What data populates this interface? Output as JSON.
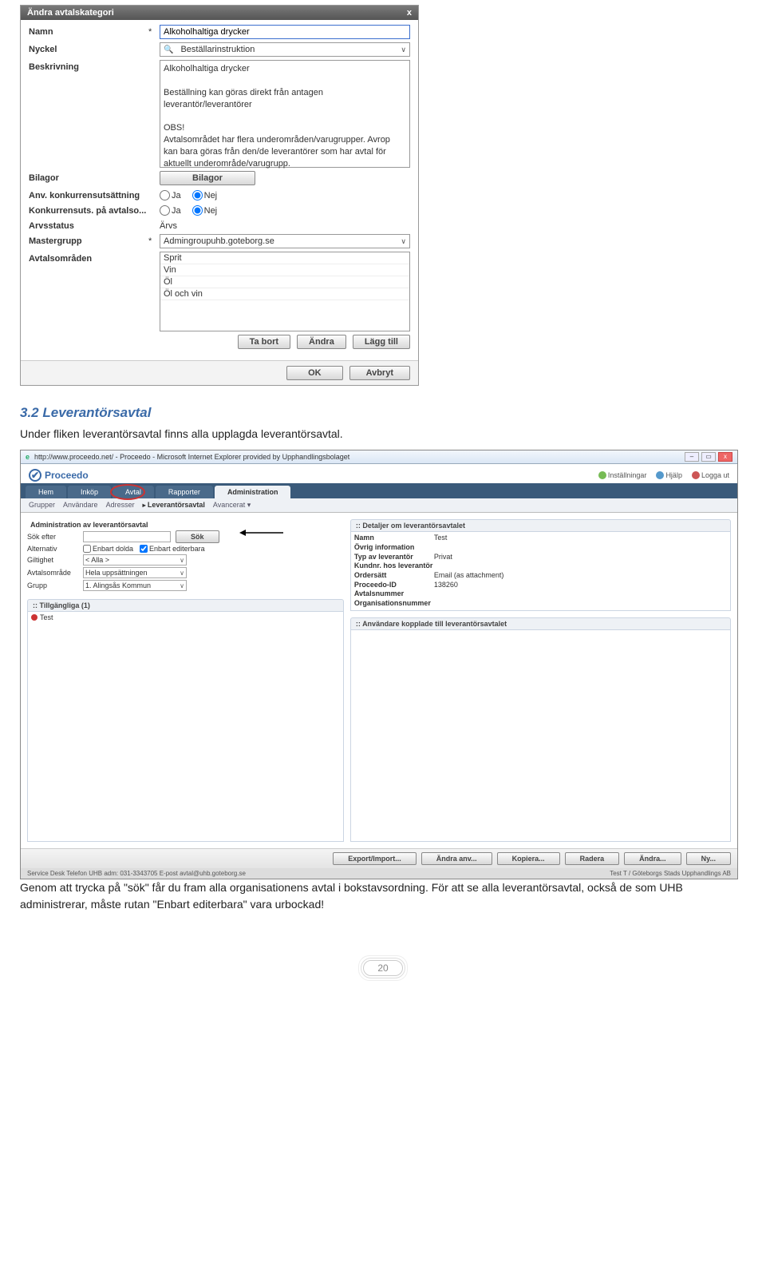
{
  "dialog": {
    "title": "Ändra avtalskategori",
    "rows": {
      "namn_label": "Namn",
      "namn_value": "Alkoholhaltiga drycker",
      "nyckel_label": "Nyckel",
      "nyckel_value": "Beställarinstruktion",
      "beskrivning_label": "Beskrivning",
      "beskrivning_value": "Alkoholhaltiga drycker\n\nBeställning kan göras direkt från antagen leverantör/leverantörer\n\nOBS!\nAvtalsområdet har flera underområden/varugrupper. Avrop kan bara göras från den/de leverantörer som har avtal för aktuellt underområde/varugrupp.",
      "bilagor_label": "Bilagor",
      "bilagor_btn": "Bilagor",
      "anv_label": "Anv. konkurrensutsättning",
      "konk_label": "Konkurrensuts. på avtalso...",
      "ja": "Ja",
      "nej": "Nej",
      "arv_label": "Arvsstatus",
      "arv_value": "Ärvs",
      "master_label": "Mastergrupp",
      "master_value": "Admingroupuhb.goteborg.se",
      "omraden_label": "Avtalsområden",
      "omraden": [
        "Sprit",
        "Vin",
        "Öl",
        "Öl och vin"
      ]
    },
    "btns": {
      "tabort": "Ta bort",
      "andra": "Ändra",
      "laggtill": "Lägg till",
      "ok": "OK",
      "avbryt": "Avbryt"
    }
  },
  "heading": "3.2  Leverantörsavtal",
  "para1": "Under fliken leverantörsavtal finns alla upplagda leverantörsavtal.",
  "admin": {
    "url_text": "http://www.proceedo.net/ - Proceedo - Microsoft Internet Explorer provided by Upphandlingsbolaget",
    "brand": "Proceedo",
    "userlinks": {
      "inst": "Inställningar",
      "hjalp": "Hjälp",
      "logga": "Logga ut"
    },
    "tabs": [
      "Hem",
      "Inköp",
      "Avtal",
      "Rapporter",
      "Administration"
    ],
    "subnav": [
      "Grupper",
      "Användare",
      "Adresser",
      "Leverantörsavtal",
      "Avancerat"
    ],
    "section_title": "Administration av leverantörsavtal",
    "search": {
      "sok_efter": "Sök efter",
      "sok_btn": "Sök",
      "alternativ": "Alternativ",
      "enbart_dolda": "Enbart dolda",
      "enbart_edit": "Enbart editerbara",
      "giltighet": "Giltighet",
      "giltighet_val": "< Alla >",
      "avtalsomrade": "Avtalsområde",
      "avtalsomrade_val": "Hela uppsättningen",
      "grupp": "Grupp",
      "grupp_val": "1. Alingsås Kommun"
    },
    "left_panel_head": "Tillgängliga (1)",
    "left_item": "Test",
    "right_panel_head": "Detaljer om leverantörsavtalet",
    "details": {
      "namn": "Namn",
      "namn_v": "Test",
      "ovrig": "Övrig information",
      "typ": "Typ av leverantör",
      "typ_v": "Privat",
      "kundnr": "Kundnr. hos leverantör",
      "ordersatt": "Ordersätt",
      "ordersatt_v": "Email (as attachment)",
      "procid": "Proceedo-ID",
      "procid_v": "138260",
      "avtalsnr": "Avtalsnummer",
      "orgnr": "Organisationsnummer"
    },
    "right_panel2": "Användare kopplade till leverantörsavtalet",
    "footer_btns": [
      "Export/Import...",
      "Ändra anv...",
      "Kopiera...",
      "Radera",
      "Ändra...",
      "Ny..."
    ],
    "status_left": "Service Desk Telefon UHB adm: 031-3343705   E-post avtal@uhb.goteborg.se",
    "status_right": "Test T / Göteborgs Stads Upphandlings AB"
  },
  "para2": "Genom att trycka på \"sök\" får du fram alla organisationens avtal i bokstavsordning. För att se alla leverantörsavtal, också de som UHB administrerar, måste rutan \"Enbart editerbara\" vara urbockad!",
  "page_number": "20"
}
